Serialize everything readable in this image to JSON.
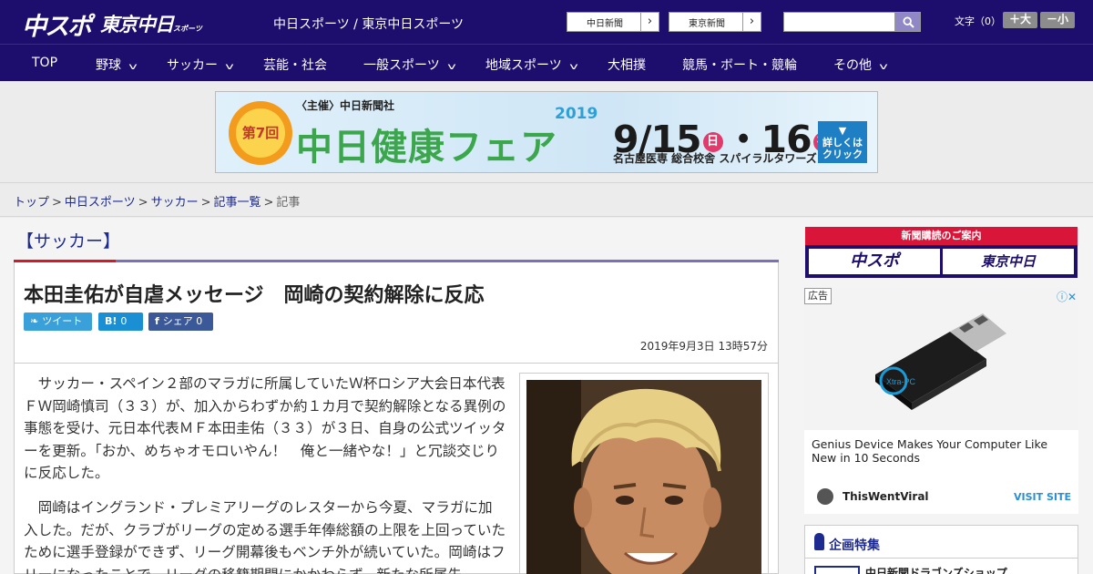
{
  "header": {
    "logo_chuspo": "中スポ",
    "logo_tokyo": "東京中日",
    "logo_tokyo_small": "スポーツ",
    "site_names": "中日スポーツ / 東京中日スポーツ",
    "paper_buttons": [
      {
        "label": "中日新聞",
        "arrow": "›"
      },
      {
        "label": "東京新聞",
        "arrow": "›"
      }
    ],
    "search": {
      "placeholder": ""
    },
    "font_size": {
      "label": "文字（0）",
      "increase": "＋大",
      "decrease": "－小"
    }
  },
  "nav": {
    "items": [
      {
        "label": "TOP",
        "chevron": ""
      },
      {
        "label": "野球",
        "chevron": "v"
      },
      {
        "label": "サッカー",
        "chevron": "v"
      },
      {
        "label": "芸能・社会",
        "chevron": ""
      },
      {
        "label": "一般スポーツ",
        "chevron": "v"
      },
      {
        "label": "地域スポーツ",
        "chevron": "v"
      },
      {
        "label": "大相撲",
        "chevron": ""
      },
      {
        "label": "競馬・ボート・競輪",
        "chevron": ""
      },
      {
        "label": "その他",
        "chevron": "v"
      }
    ]
  },
  "banner": {
    "badge": "第7回",
    "host": "〈主催〉中日新聞社",
    "title": "中日健康フェア",
    "year": "2019",
    "date_a": "9/15",
    "day_a": "日",
    "date_b": "・16",
    "day_b": "祝",
    "venue": "名古屋医専 総合校舎 スパイラルタワーズ",
    "click": "▼\n詳しくは\nクリック"
  },
  "breadcrumb": {
    "items": [
      "トップ",
      "中日スポーツ",
      "サッカー",
      "記事一覧"
    ],
    "separator": ">",
    "current": "記事"
  },
  "article": {
    "category": "【サッカー】",
    "headline": "本田圭佑が自虐メッセージ　岡崎の契約解除に反応",
    "share": {
      "tweet": "ツイート",
      "hatena_icon": "B!",
      "hatena_count": "0",
      "facebook_icon": "f",
      "facebook_label": "シェア",
      "facebook_count": "0"
    },
    "date": "2019年9月3日 13時57分",
    "paragraphs": [
      "サッカー・スペイン２部のマラガに所属していたＷ杯ロシア大会日本代表ＦＷ岡崎慎司（３３）が、加入からわずか約１カ月で契約解除となる異例の事態を受け、元日本代表ＭＦ本田圭佑（３３）が３日、自身の公式ツイッターを更新。「おか、めちゃオモロいやん！　俺と一緒やな！」と冗談交じりに反応した。",
      "岡崎はイングランド・プレミアリーグのレスターから今夏、マラガに加入した。だが、クラブがリーグの定める選手年俸総額の上限を上回っていたために選手登録ができず、リーグ開幕後もベンチ外が続いていた。岡崎はフリーになったことで、リーグの移籍期間にかかわらず、新たな所属先"
    ]
  },
  "sidebar": {
    "subscribe": {
      "heading": "新聞購読のご案内",
      "logo_a": "中スポ",
      "logo_b": "東京中日"
    },
    "ad": {
      "label": "広告",
      "product_text": "Xtra-PC",
      "text": "Genius Device Makes Your Computer Like New in 10 Seconds",
      "source": "ThisWentViral",
      "visit": "VISIT SITE"
    },
    "feature": {
      "title": "企画特集",
      "item": "中日新聞ドラゴンズショップ"
    }
  },
  "colors": {
    "brand": "#1d0e6e",
    "accent_red": "#d11a2a",
    "link": "#1d2a8f"
  }
}
